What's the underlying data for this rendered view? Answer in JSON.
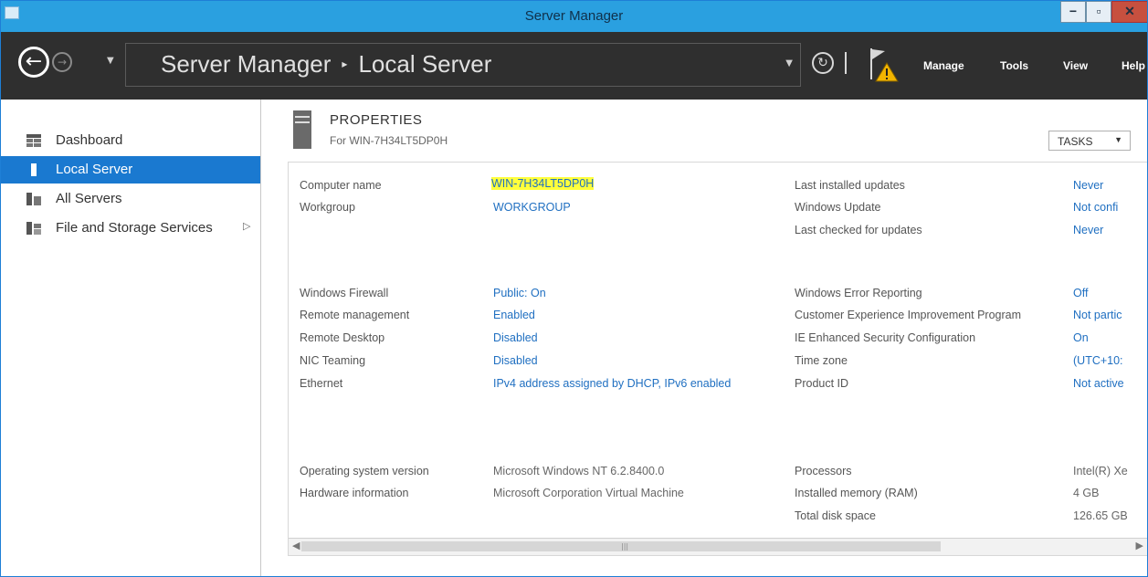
{
  "window": {
    "title": "Server Manager",
    "controls": {
      "minimize": "−",
      "maximize": "▫",
      "close": "✕"
    }
  },
  "nav": {
    "breadcrumb": [
      "Server Manager",
      "Local Server"
    ],
    "menu": [
      "Manage",
      "Tools",
      "View",
      "Help"
    ]
  },
  "sidebar": {
    "items": [
      {
        "label": "Dashboard",
        "icon": "dashboard-icon",
        "active": false
      },
      {
        "label": "Local Server",
        "icon": "server-icon",
        "active": true
      },
      {
        "label": "All Servers",
        "icon": "servers-icon",
        "active": false
      },
      {
        "label": "File and Storage Services",
        "icon": "storage-icon",
        "active": false
      }
    ]
  },
  "properties": {
    "title": "PROPERTIES",
    "subtitle": "For WIN-7H34LT5DP0H",
    "tasks_label": "TASKS",
    "left": [
      {
        "label": "Computer name",
        "value": "WIN-7H34LT5DP0H"
      },
      {
        "label": "Workgroup",
        "value": "WORKGROUP"
      },
      {
        "label": "Windows Firewall",
        "value": "Public: On"
      },
      {
        "label": "Remote management",
        "value": "Enabled"
      },
      {
        "label": "Remote Desktop",
        "value": "Disabled"
      },
      {
        "label": "NIC Teaming",
        "value": "Disabled"
      },
      {
        "label": "Ethernet",
        "value": "IPv4 address assigned by DHCP, IPv6 enabled"
      },
      {
        "label": "Operating system version",
        "value": "Microsoft Windows NT 6.2.8400.0"
      },
      {
        "label": "Hardware information",
        "value": "Microsoft Corporation Virtual Machine"
      }
    ],
    "right": [
      {
        "label": "Last installed updates",
        "value": "Never"
      },
      {
        "label": "Windows Update",
        "value": "Not confi"
      },
      {
        "label": "Last checked for updates",
        "value": "Never"
      },
      {
        "label": "Windows Error Reporting",
        "value": "Off"
      },
      {
        "label": "Customer Experience Improvement Program",
        "value": "Not partic"
      },
      {
        "label": "IE Enhanced Security Configuration",
        "value": "On"
      },
      {
        "label": "Time zone",
        "value": "(UTC+10:"
      },
      {
        "label": "Product ID",
        "value": "Not active"
      },
      {
        "label": "Processors",
        "value": "Intel(R) Xe"
      },
      {
        "label": "Installed memory (RAM)",
        "value": "4 GB"
      },
      {
        "label": "Total disk space",
        "value": "126.65 GB"
      }
    ]
  },
  "colors": {
    "titlebar": "#2aa0e0",
    "navbar": "#2f2f2f",
    "active_item": "#1a79d0",
    "link": "#1f6fc1",
    "highlight": "#ffff3c"
  }
}
